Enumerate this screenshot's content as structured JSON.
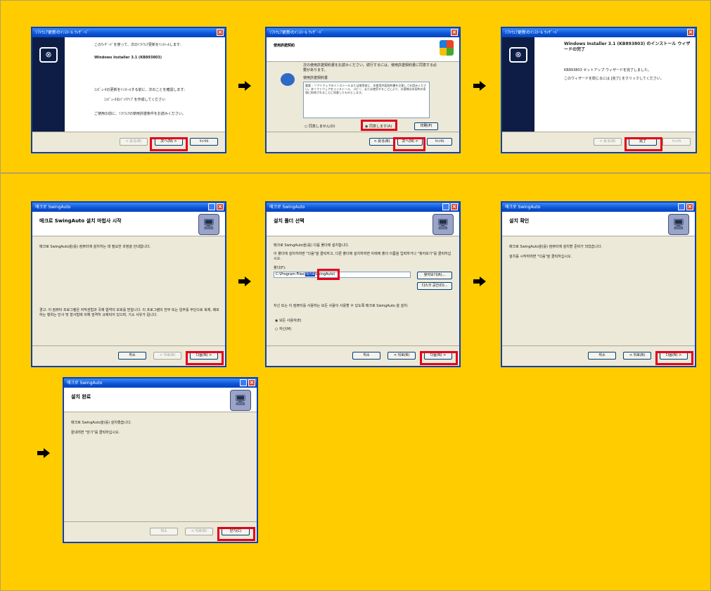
{
  "colors": {
    "panel_bg": "#ffcc00",
    "highlight": "#e3001b",
    "titlebar": "#0a52d8"
  },
  "row1": {
    "dlg1": {
      "title": "ｿﾌﾄｳｪｱ更新のｲﾝｽﾄｰﾙ ｳｨｻﾞｰﾄﾞ",
      "intro": "このｳｨｻﾞｰﾄﾞを使って、次のｿﾌﾄｳｪｱ更新をｲﾝｽﾄｰﾙします:",
      "product": "Windows Installer 3.1 (KB893803)",
      "mid": "ｺﾝﾋﾟｭｰﾀの更新をｲﾝｽﾄｰﾙする前に、次のことを確認します:",
      "note": "ｺﾝﾋﾟｭｰﾀのﾊﾞｯｸｱｯﾌﾟを作成してください",
      "bottom": "ご使用の前に、ｿﾌﾄｳｪｱの使用許諾条件をお読みください。",
      "back": "< 戻る(B)",
      "next": "次へ(N) >",
      "cancel": "ｷｬﾝｾﾙ"
    },
    "dlg2": {
      "title": "ｿﾌﾄｳｪｱ更新のｲﾝｽﾄｰﾙ ｳｨｻﾞｰﾄﾞ",
      "header": "使用許諾契約",
      "desc": "次の使用許諾契約書をお読みください。続行するには、使用許諾契約書に同意する必要があります。",
      "license_title": "使用許諾契約書",
      "license_text": "重要 – ソフトウェアのインストールまたは使用前に、本使用許諾契約書を注意してお読みください。本ソフトウェアをインストール、コピー、または使用することにより、お客様は本契約の条項に拘束されることに同意したものとします。",
      "disagree": "同意しません(D)",
      "agree": "同意します(A)",
      "print": "印刷(P)",
      "back": "< 戻る(B)",
      "next": "次へ(N) >",
      "cancel": "ｷｬﾝｾﾙ"
    },
    "dlg3": {
      "title": "ｿﾌﾄｳｪｱ更新のｲﾝｽﾄｰﾙ ｳｨｻﾞｰﾄﾞ",
      "heading": "Windows Installer 3.1 (KB893803) のインストール ウィザードの完了",
      "line1": "KB893803 セットアップ ウィザードを完了しました。",
      "line2": "このウィザードを閉じるには [完了] をクリックしてください。",
      "back": "< 戻る(B)",
      "finish": "完了",
      "cancel": "ｷｬﾝｾﾙ"
    }
  },
  "row2": {
    "dlg4": {
      "title": "매크로 SwingAuto",
      "header": "매크로 SwingAuto 설치 마법사 시작",
      "desc": "매크로 SwingAuto을(를) 컴퓨터에 설치하는 데 필요한 과정을 안내합니다.",
      "warning": "경고: 이 컴퓨터 프로그램은 저작권법과 국제 협약의 보호를 받습니다. 이 프로그램의 전부 또는 일부를 무단으로 복제, 배포하는 행위는 민사 및 형사법에 의해 엄격히 규제되어 있으며, 기소 사유가 됩니다.",
      "cancel": "취소",
      "back": "< 뒤로(B)",
      "next": "다음(N) >"
    },
    "dlg5": {
      "title": "매크로 SwingAuto",
      "header": "설치 폴더 선택",
      "desc1": "매크로 SwingAuto을(를) 다음 폴더에 설치합니다.",
      "desc2": "이 폴더에 설치하려면 \"다음\"을 클릭하고, 다른 폴더에 설치하려면 아래에 폴더 이름을 입력하거나 \"찾아보기\"를 클릭하십시오.",
      "folder_label": "폴더(F):",
      "folder_prefix": "C:\\Program Files\\",
      "folder_sel": "매크로",
      "folder_suffix": "SwingAuto\\",
      "browse": "찾아보기(R)...",
      "diskcost": "디스크 공간(D)...",
      "users_text": "자신 또는 이 컴퓨터를 사용하는 모든 사람이 사용할 수 있도록 매크로 SwingAuto 을 설치:",
      "everyone": "모든 사용자(E)",
      "justme": "자신(M)",
      "cancel": "취소",
      "back": "< 뒤로(B)",
      "next": "다음(N) >"
    },
    "dlg6": {
      "title": "매크로 SwingAuto",
      "header": "설치 확인",
      "line1": "매크로 SwingAuto을(를) 컴퓨터에 설치할 준비가 되었습니다.",
      "line2": "설치를 시작하려면 \"다음\"을 클릭하십시오.",
      "cancel": "취소",
      "back": "< 뒤로(B)",
      "next": "다음(N) >"
    },
    "dlg7": {
      "title": "매크로 SwingAuto",
      "header": "설치 완료",
      "line1": "매크로 SwingAuto을(를) 설치했습니다.",
      "line2": "끝내려면 \"닫기\"를 클릭하십시오.",
      "cancel": "취소",
      "back": "< 뒤로(B)",
      "close": "닫기(C)"
    }
  }
}
